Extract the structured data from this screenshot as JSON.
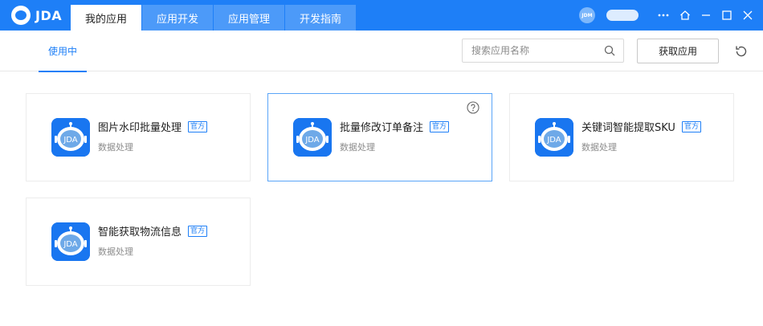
{
  "brand": {
    "logo_text": "JDA"
  },
  "tabs": [
    {
      "label": "我的应用",
      "active": true
    },
    {
      "label": "应用开发",
      "active": false
    },
    {
      "label": "应用管理",
      "active": false
    },
    {
      "label": "开发指南",
      "active": false
    }
  ],
  "user": {
    "avatar_text": "JDM"
  },
  "icons": {
    "more": "more-icon",
    "home": "home-icon",
    "minimize": "minimize-icon",
    "maximize": "maximize-icon",
    "close": "close-icon"
  },
  "subtabs": [
    {
      "label": "使用中",
      "active": true
    }
  ],
  "search": {
    "placeholder": "搜索应用名称",
    "value": ""
  },
  "actions": {
    "get_app_label": "获取应用"
  },
  "apps": [
    {
      "icon_text": "JDA",
      "name": "图片水印批量处理",
      "badge": "官方",
      "category": "数据处理"
    },
    {
      "icon_text": "JDA",
      "name": "批量修改订单备注",
      "badge": "官方",
      "category": "数据处理"
    },
    {
      "icon_text": "JDA",
      "name": "关键词智能提取SKU",
      "badge": "官方",
      "category": "数据处理"
    },
    {
      "icon_text": "JDA",
      "name": "智能获取物流信息",
      "badge": "官方",
      "category": "数据处理"
    }
  ],
  "colors": {
    "primary": "#1e7ff7",
    "tab_inactive": "#4c9af9",
    "selected_border": "#5aa5f8"
  }
}
